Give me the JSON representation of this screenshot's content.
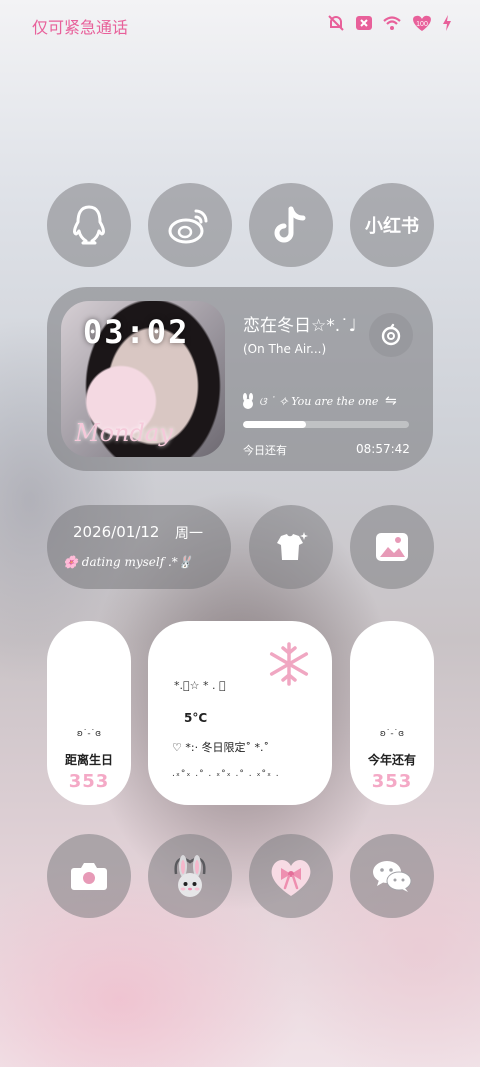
{
  "status_bar": {
    "carrier": "仅可紧急通话",
    "icons": [
      "bell-muted-icon",
      "no-sim-icon",
      "wifi-icon",
      "battery-icon",
      "charging-icon"
    ],
    "battery": "100"
  },
  "apps_row1": [
    {
      "name": "qq",
      "icon": "qq-penguin-icon"
    },
    {
      "name": "weibo",
      "icon": "weibo-icon"
    },
    {
      "name": "douyin",
      "icon": "tiktok-note-icon"
    },
    {
      "name": "xiaohongshu",
      "label": "小红书"
    }
  ],
  "music_widget": {
    "cover_time": "03:02",
    "cover_script": "Monday",
    "song_title": "恋在冬日☆*.˙♩",
    "song_sub": "(On The Air...)",
    "lyric": "ଓ ˙ ✧ You are the one",
    "progress": 0.38,
    "remaining_label": "今日还有",
    "remaining_value": "08:57:42"
  },
  "date_widget": {
    "date": "2026/01/12",
    "weekday": "周一",
    "line": "🌸 dating myself .*🐰"
  },
  "white_left": {
    "deco": "ʚ˙-˙ɞ",
    "label": "距离生日",
    "number": "353"
  },
  "white_mid": {
    "deco_top": "*.ﾟ☆ * . ﾟ",
    "temp": "5°C",
    "weather_line": "♡ *:· 冬日限定˚ *.˚",
    "deco_bottom": ".ₓ°ₓ .° . ₓ°ₓ .° . ₓ°ₓ ."
  },
  "white_right": {
    "deco": "ʚ˙-˙ɞ",
    "label": "今年还有",
    "number": "353"
  },
  "apps_row2": [
    {
      "name": "camera",
      "icon": "camera-icon"
    },
    {
      "name": "bunny",
      "icon": "bunny-icon"
    },
    {
      "name": "heart",
      "icon": "heart-bow-icon"
    },
    {
      "name": "wechat",
      "icon": "wechat-icon"
    }
  ],
  "colors": {
    "accent": "#e8609a",
    "pink": "#f4a9c6",
    "glass": "#808084"
  }
}
